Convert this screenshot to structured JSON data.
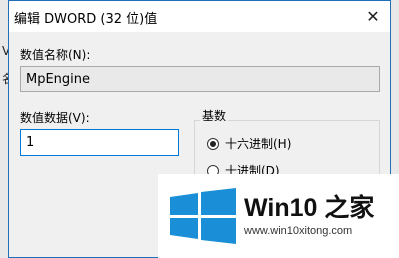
{
  "window": {
    "title": "编辑 DWORD (32 位)值",
    "close_glyph": "✕"
  },
  "value_name": {
    "label": "数值名称(N):",
    "value": "MpEngine"
  },
  "value_data": {
    "label": "数值数据(V):",
    "value": "1"
  },
  "base": {
    "title": "基数",
    "options": [
      {
        "label": "十六进制(H)",
        "selected": true
      },
      {
        "label": "十进制(D)",
        "selected": false
      }
    ]
  },
  "watermark": {
    "title": "Win10 之家",
    "url": "www.win10xitong.com",
    "logo_color": "#1a8fd8"
  }
}
